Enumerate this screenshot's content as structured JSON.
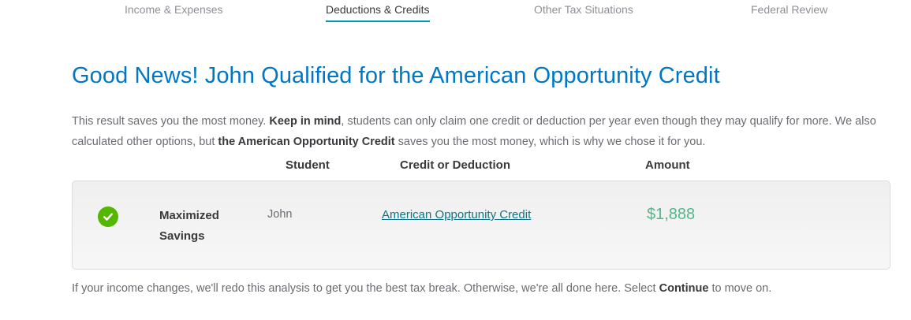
{
  "tabs": [
    {
      "label": "Income & Expenses",
      "active": false
    },
    {
      "label": "Deductions & Credits",
      "active": true
    },
    {
      "label": "Other Tax Situations",
      "active": false
    },
    {
      "label": "Federal Review",
      "active": false
    }
  ],
  "headline": "Good News! John Qualified for the American Opportunity Credit",
  "intro": {
    "part1": "This result saves you the most money. ",
    "bold1": "Keep in mind",
    "part2": ", students can only claim one credit or deduction per year even though they may qualify for more. We also calculated other options, but ",
    "bold2": "the American Opportunity Credit",
    "part3": " saves you the most money, which is why we chose it for you."
  },
  "table": {
    "headers": {
      "student": "Student",
      "credit": "Credit or Deduction",
      "amount": "Amount"
    },
    "row": {
      "status": "Maximized Savings",
      "student": "John",
      "credit": "American Opportunity Credit",
      "amount": "$1,888"
    }
  },
  "footer": {
    "part1": "If your income changes, we'll redo this analysis to get you the best tax break. Otherwise, we're all done here. Select ",
    "bold": "Continue",
    "part2": " to move on."
  },
  "colors": {
    "accent": "#0077c5",
    "tab_underline": "#0097a7",
    "success": "#53b700",
    "amount": "#52b788",
    "link": "#0d7586"
  },
  "icons": {
    "status": "check-circle-icon"
  }
}
